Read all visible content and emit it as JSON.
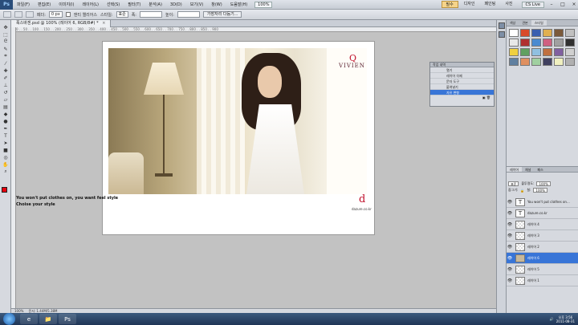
{
  "menubar": {
    "logo": "Ps",
    "items": [
      "파일(F)",
      "편집(E)",
      "이미지(I)",
      "레이어(L)",
      "선택(S)",
      "필터(T)",
      "분석(A)",
      "3D(D)",
      "보기(V)",
      "창(W)",
      "도움말(H)"
    ],
    "zoom": "100%",
    "workspaces": [
      "필수",
      "디자인",
      "페인팅",
      "사진"
    ],
    "active_workspace": "필수",
    "cs_live": "CS Live",
    "window_controls": [
      "–",
      "□",
      "×"
    ]
  },
  "options": {
    "feather_label": "페더:",
    "feather_value": "0 px",
    "antialias_label": "앤티 앨리어스",
    "style_label": "스타일:",
    "style_value": "표준",
    "width_label": "폭:",
    "height_label": "높이:",
    "refine_button": "가장자리 다듬기..."
  },
  "document_tab": {
    "title": "폭스바겐.psd @ 100% (레이어 6, RGB/8#) *",
    "close": "×"
  },
  "ruler_ticks": "0 . . 50 . . 100 . . 150 . . 200 . . 250 . . 300 . . 350 . . 400 . . 450 . . 500 . . 550 . . 600 . . 650 . . 700 . . 750 . . 800 . . 850 . . 900",
  "ad": {
    "brand_mark": "Q",
    "brand_text": "VIVIEN",
    "line1": "You won't put clothes on, you want feel style",
    "line2": "Choise your style",
    "logo": "d",
    "site": "dazure.co.kr"
  },
  "status": {
    "zoom": "100%",
    "doc": "문서: 1.44M/5.38M"
  },
  "history": {
    "title": "작업 내역",
    "items": [
      "열기",
      "레이어 삭제",
      "문자 도구",
      "붙여넣기",
      "자유 변형"
    ],
    "selected_index": 4
  },
  "right_panel": {
    "tabs": [
      "색상",
      "견본",
      "스타일"
    ],
    "active_tab": "스타일",
    "styles_colors": [
      "#ffffff",
      "#d94a2a",
      "#3a5fb0",
      "#e0b050",
      "#7b5a3a",
      "#c0c0c0",
      "#e8e8e8",
      "#b03030",
      "#4a8ad0",
      "#d06080",
      "#a0a0a0",
      "#303030",
      "#f0d040",
      "#60a060",
      "#90c0e0",
      "#c07040",
      "#8060a0",
      "#d0d0d0",
      "#6080a0",
      "#e09060",
      "#a0d0a0",
      "#404060",
      "#f0f0c0",
      "#b0b0b0"
    ]
  },
  "layers_panel": {
    "tabs": [
      "레이어",
      "채널",
      "패스"
    ],
    "blend_mode": "표준",
    "opacity_label": "불투명도:",
    "opacity": "100%",
    "lock_label": "잠그기:",
    "fill_label": "칠:",
    "fill": "100%",
    "layers": [
      {
        "name": "You won't put clothes on...",
        "type": "text"
      },
      {
        "name": "dazure.co.kr",
        "type": "text"
      },
      {
        "name": "레이어 4",
        "type": "raster"
      },
      {
        "name": "레이어 3",
        "type": "raster"
      },
      {
        "name": "레이어 2",
        "type": "raster"
      },
      {
        "name": "레이어 6",
        "type": "image"
      },
      {
        "name": "레이어 5",
        "type": "raster"
      },
      {
        "name": "레이어 1",
        "type": "raster"
      }
    ],
    "selected_index": 5
  },
  "taskbar": {
    "apps": [
      "e",
      "📁",
      "Ps"
    ],
    "time": "오후 3:56",
    "date": "2011-08-31"
  }
}
